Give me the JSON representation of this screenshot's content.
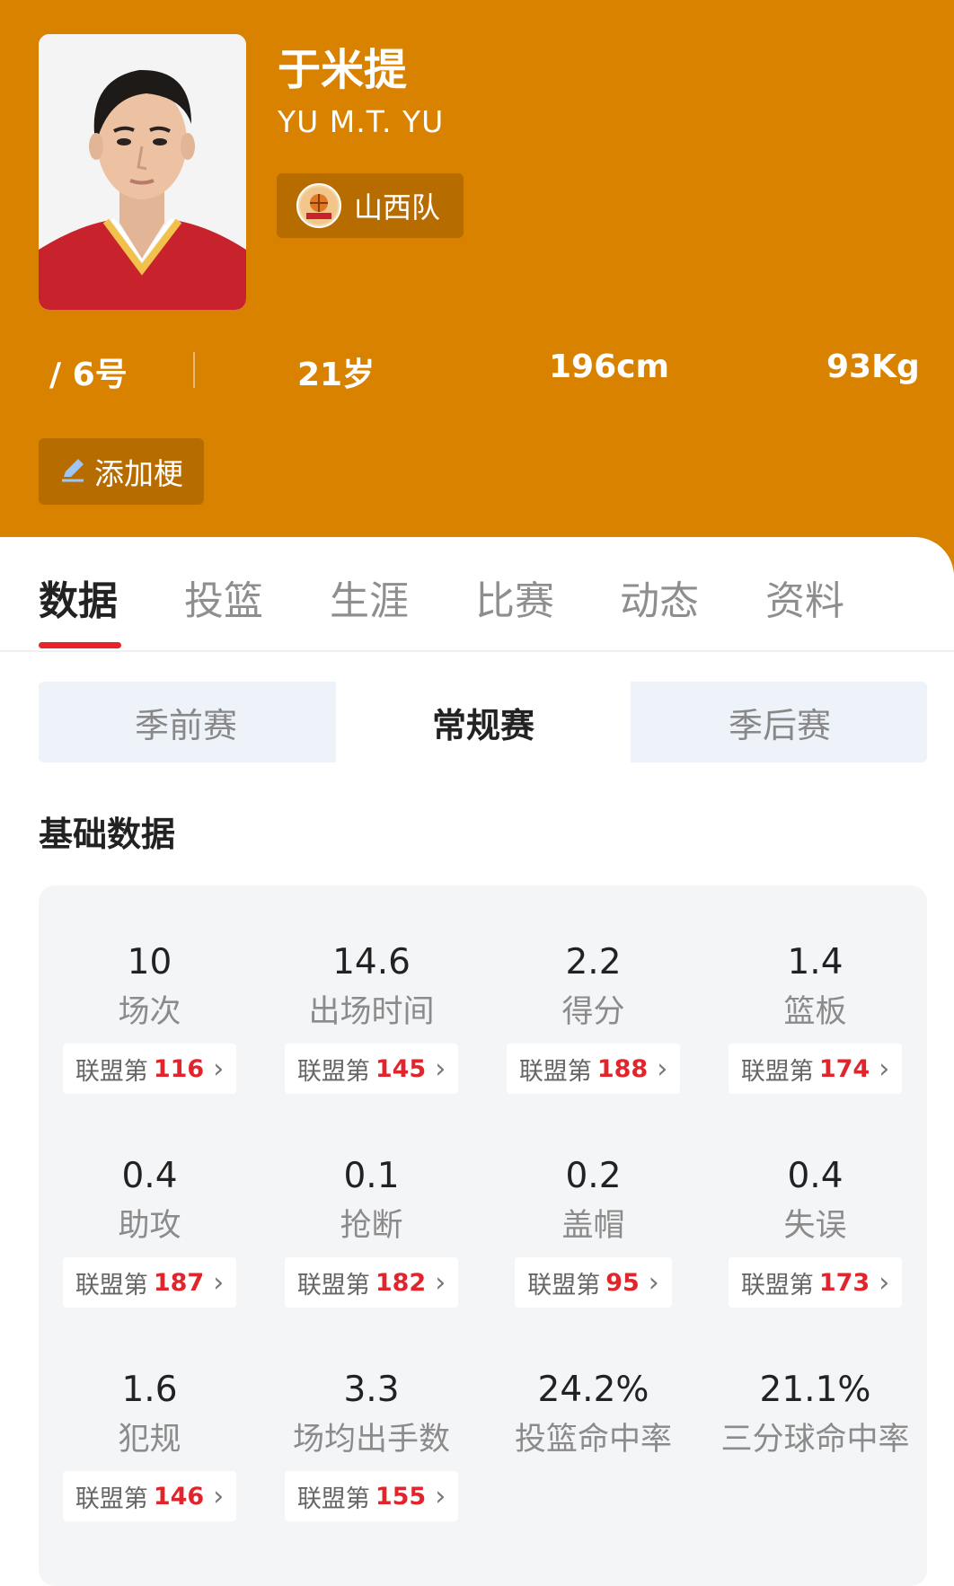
{
  "player": {
    "name": "于米提",
    "english_name": "YU M.T. YU",
    "team": "山西队",
    "number": "/ 6号",
    "age": "21岁",
    "height": "196cm",
    "weight": "93Kg",
    "add_meme_label": "添加梗"
  },
  "tabs": [
    {
      "label": "数据",
      "active": true
    },
    {
      "label": "投篮",
      "active": false
    },
    {
      "label": "生涯",
      "active": false
    },
    {
      "label": "比赛",
      "active": false
    },
    {
      "label": "动态",
      "active": false
    },
    {
      "label": "资料",
      "active": false
    }
  ],
  "season_segments": [
    {
      "label": "季前赛",
      "active": false
    },
    {
      "label": "常规赛",
      "active": true
    },
    {
      "label": "季后赛",
      "active": false
    }
  ],
  "section_title": "基础数据",
  "rank_prefix": "联盟第",
  "stats": [
    {
      "value": "10",
      "label": "场次",
      "rank": "116"
    },
    {
      "value": "14.6",
      "label": "出场时间",
      "rank": "145"
    },
    {
      "value": "2.2",
      "label": "得分",
      "rank": "188"
    },
    {
      "value": "1.4",
      "label": "篮板",
      "rank": "174"
    },
    {
      "value": "0.4",
      "label": "助攻",
      "rank": "187"
    },
    {
      "value": "0.1",
      "label": "抢断",
      "rank": "182"
    },
    {
      "value": "0.2",
      "label": "盖帽",
      "rank": "95"
    },
    {
      "value": "0.4",
      "label": "失误",
      "rank": "173"
    },
    {
      "value": "1.6",
      "label": "犯规",
      "rank": "146"
    },
    {
      "value": "3.3",
      "label": "场均出手数",
      "rank": "155"
    },
    {
      "value": "24.2%",
      "label": "投篮命中率"
    },
    {
      "value": "21.1%",
      "label": "三分球命中率"
    }
  ],
  "colors": {
    "header": "#D98200",
    "accent_red": "#E1252C",
    "segment_bg": "#eef2f9",
    "card_bg": "#f4f5f7"
  }
}
